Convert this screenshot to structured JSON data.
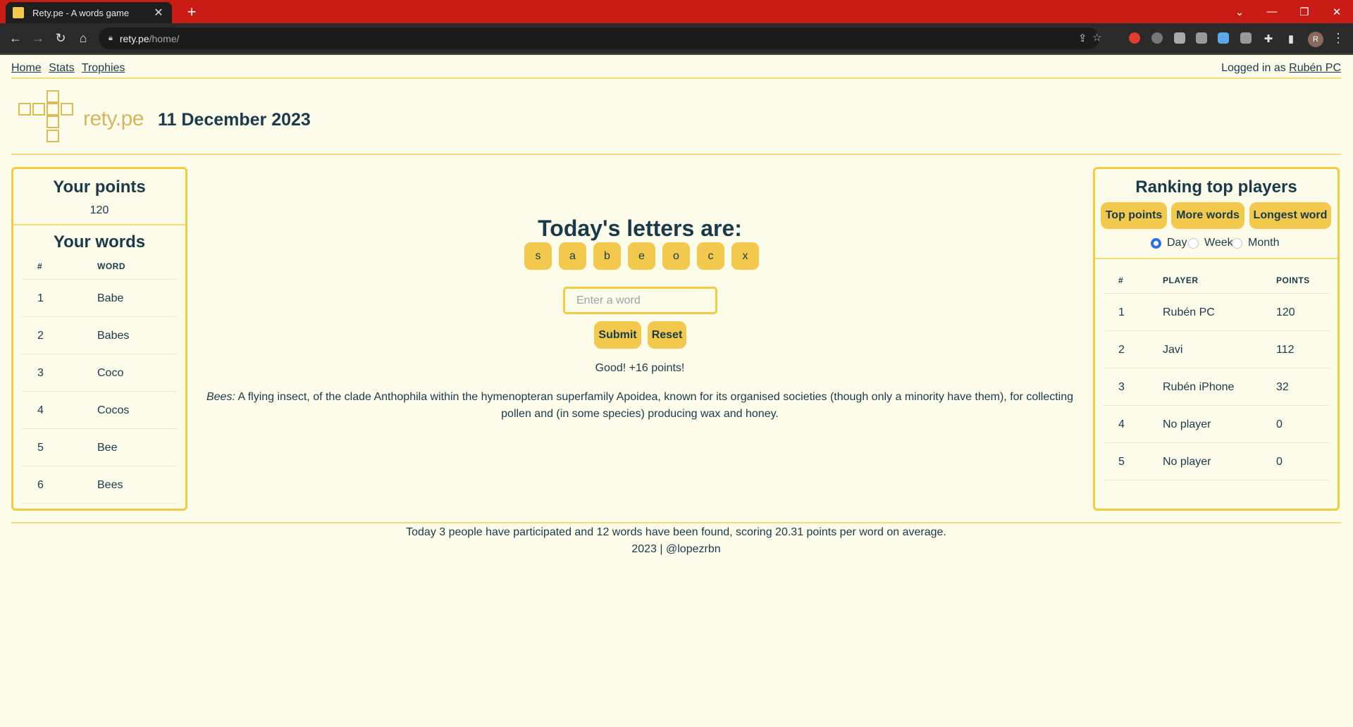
{
  "browser": {
    "tab_title": "Rety.pe - A words game",
    "url_host": "rety.pe",
    "url_path": "/home/",
    "profile_initial": "R"
  },
  "nav": {
    "home": "Home",
    "stats": "Stats",
    "trophies": "Trophies",
    "login_prefix": "Logged in as",
    "user": "Rubén PC"
  },
  "header": {
    "brand": "rety.pe",
    "date": "11 December 2023"
  },
  "left_panel": {
    "points_title": "Your points",
    "points_value": "120",
    "words_title": "Your words",
    "col_num": "#",
    "col_word": "WORD",
    "words": [
      {
        "n": "1",
        "word": "Babe"
      },
      {
        "n": "2",
        "word": "Babes"
      },
      {
        "n": "3",
        "word": "Coco"
      },
      {
        "n": "4",
        "word": "Cocos"
      },
      {
        "n": "5",
        "word": "Bee"
      },
      {
        "n": "6",
        "word": "Bees"
      }
    ]
  },
  "main": {
    "title": "Today's letters are:",
    "letters": [
      "s",
      "a",
      "b",
      "e",
      "o",
      "c",
      "x"
    ],
    "input_placeholder": "Enter a word",
    "submit": "Submit",
    "reset": "Reset",
    "feedback": "Good! +16 points!",
    "definition_word": "Bees:",
    "definition_text": "A flying insect, of the clade Anthophila within the hymenopteran superfamily Apoidea, known for its organised societies (though only a minority have them), for collecting pollen and (in some species) producing wax and honey."
  },
  "ranking": {
    "title": "Ranking top players",
    "buttons": [
      "Top points",
      "More words",
      "Longest word"
    ],
    "periods": [
      "Day",
      "Week",
      "Month"
    ],
    "selected_period": "Day",
    "col_num": "#",
    "col_player": "PLAYER",
    "col_points": "POINTS",
    "rows": [
      {
        "n": "1",
        "player": "Rubén PC",
        "points": "120"
      },
      {
        "n": "2",
        "player": "Javi",
        "points": "112"
      },
      {
        "n": "3",
        "player": "Rubén iPhone",
        "points": "32"
      },
      {
        "n": "4",
        "player": "No player",
        "points": "0"
      },
      {
        "n": "5",
        "player": "No player",
        "points": "0"
      }
    ]
  },
  "footer": {
    "stats": "Today 3 people have participated and 12 words have been found, scoring 20.31 points per word on average.",
    "credit": "2023 | @lopezrbn"
  }
}
